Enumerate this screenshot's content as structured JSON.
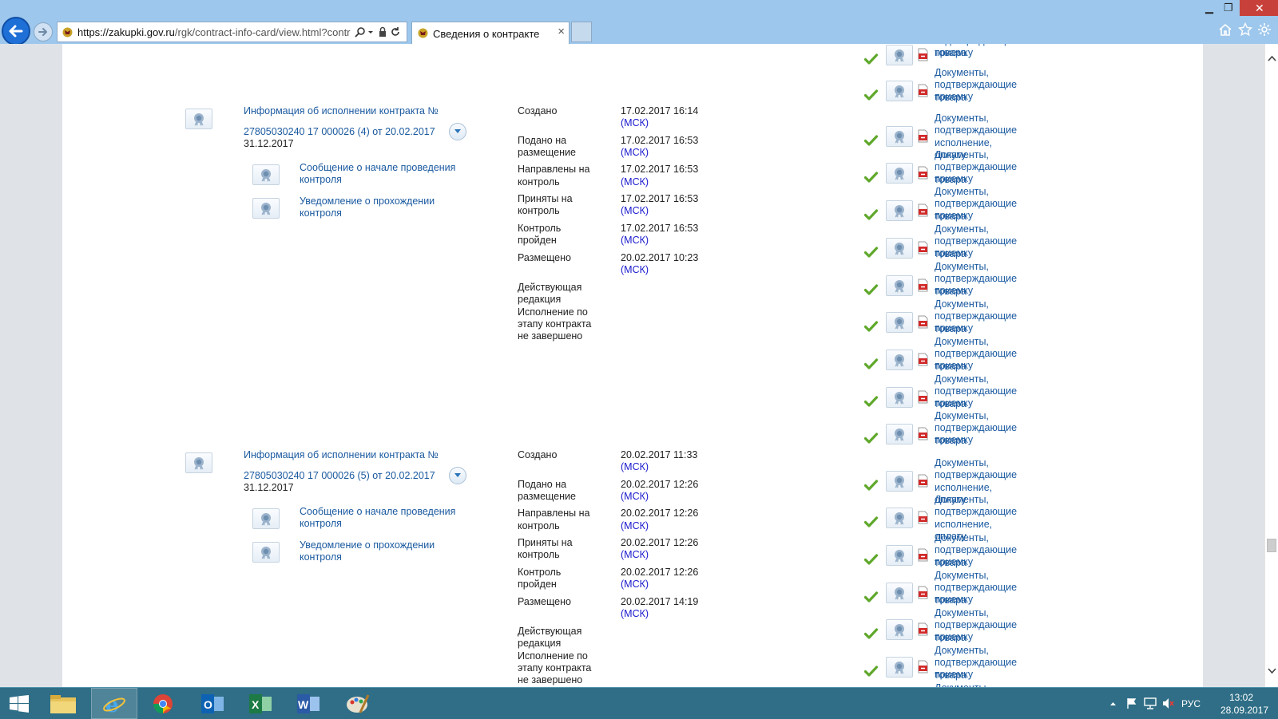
{
  "browser": {
    "address_url_main": "https://zakupki.gov.ru",
    "address_url_rest": "/rgk/contract-info-card/view.html?contrac",
    "tab_title": "Сведения о контракте",
    "tab_close": "×"
  },
  "labels": {
    "msk": "(МСК)"
  },
  "records": [
    {
      "title_line1": "Информация об исполнении контракта №",
      "title_line2": "27805030240 17 000026 (4) от 20.02.2017",
      "subdate": "31.12.2017",
      "sub_docs": [
        {
          "l1": "Сообщение о начале проведения",
          "l2": "контроля"
        },
        {
          "l1": "Уведомление о прохождении",
          "l2": "контроля"
        }
      ],
      "statuses": [
        {
          "l1": "Создано",
          "l2": "",
          "date": "17.02.2017 16:14"
        },
        {
          "l1": "Подано на",
          "l2": "размещение",
          "date": "17.02.2017 16:53"
        },
        {
          "l1": "Направлены на",
          "l2": "контроль",
          "date": "17.02.2017 16:53"
        },
        {
          "l1": "Приняты на",
          "l2": "контроль",
          "date": "17.02.2017 16:53"
        },
        {
          "l1": "Контроль",
          "l2": "пройден",
          "date": "17.02.2017 16:53"
        },
        {
          "l1": "Размещено",
          "l2": "",
          "date": "20.02.2017 10:23"
        }
      ],
      "note": [
        "Действующая",
        "редакция",
        "Исполнение по",
        "этапу контракта",
        "не завершено"
      ]
    },
    {
      "title_line1": "Информация об исполнении контракта №",
      "title_line2": "27805030240 17 000026 (5) от 20.02.2017",
      "subdate": "31.12.2017",
      "sub_docs": [
        {
          "l1": "Сообщение о начале проведения",
          "l2": "контроля"
        },
        {
          "l1": "Уведомление о прохождении",
          "l2": "контроля"
        }
      ],
      "statuses": [
        {
          "l1": "Создано",
          "l2": "",
          "date": "20.02.2017 11:33"
        },
        {
          "l1": "Подано на",
          "l2": "размещение",
          "date": "20.02.2017 12:26"
        },
        {
          "l1": "Направлены на",
          "l2": "контроль",
          "date": "20.02.2017 12:26"
        },
        {
          "l1": "Приняты на",
          "l2": "контроль",
          "date": "20.02.2017 12:26"
        },
        {
          "l1": "Контроль",
          "l2": "пройден",
          "date": "20.02.2017 12:26"
        },
        {
          "l1": "Размещено",
          "l2": "",
          "date": "20.02.2017 14:19"
        }
      ],
      "note": [
        "Действующая",
        "редакция",
        "Исполнение по",
        "этапу контракта",
        "не завершено"
      ]
    }
  ],
  "right_docs": [
    {
      "lines": [
        "подтверждающие приемку",
        "товара"
      ]
    },
    {
      "lines": [
        "Документы,",
        "подтверждающие приемку",
        "товара"
      ]
    },
    {
      "lines": [
        "Документы,",
        "подтверждающие",
        "исполнение, оплату"
      ]
    },
    {
      "lines": [
        "Документы,",
        "подтверждающие приемку",
        "товара"
      ]
    },
    {
      "lines": [
        "Документы,",
        "подтверждающие приемку",
        "товара"
      ]
    },
    {
      "lines": [
        "Документы,",
        "подтверждающие приемку",
        "товара"
      ]
    },
    {
      "lines": [
        "Документы,",
        "подтверждающие приемку",
        "товара"
      ]
    },
    {
      "lines": [
        "Документы,",
        "подтверждающие приемку",
        "товара"
      ]
    },
    {
      "lines": [
        "Документы,",
        "подтверждающие приемку",
        "товара"
      ]
    },
    {
      "lines": [
        "Документы,",
        "подтверждающие приемку",
        "товара"
      ]
    },
    {
      "lines": [
        "Документы,",
        "подтверждающие приемку",
        "товара"
      ]
    },
    {
      "lines": [
        "Документы,",
        "подтверждающие",
        "исполнение, оплату"
      ]
    },
    {
      "lines": [
        "Документы,",
        "подтверждающие",
        "исполнение, оплату"
      ]
    },
    {
      "lines": [
        "Документы,",
        "подтверждающие приемку",
        "товара"
      ]
    },
    {
      "lines": [
        "Документы,",
        "подтверждающие приемку",
        "товара"
      ]
    },
    {
      "lines": [
        "Документы,",
        "подтверждающие приемку",
        "товара"
      ]
    },
    {
      "lines": [
        "Документы,",
        "подтверждающие приемку",
        "товара"
      ]
    },
    {
      "lines": [
        "Документы,"
      ]
    }
  ],
  "taskbar": {
    "apps": [
      "start-button",
      "file-explorer",
      "internet-explorer",
      "chrome",
      "outlook",
      "excel",
      "word",
      "paint"
    ],
    "lang": "РУС",
    "time": "13:02",
    "date": "28.09.2017"
  }
}
